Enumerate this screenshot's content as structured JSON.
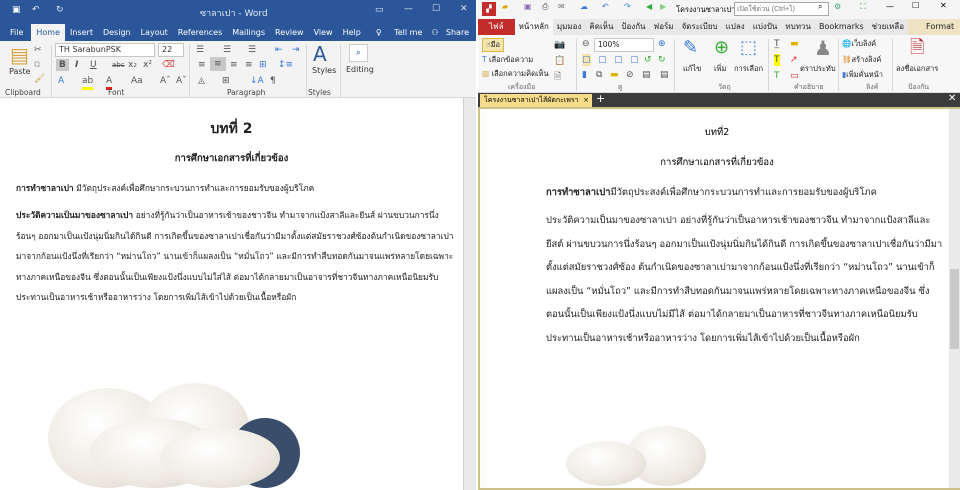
{
  "word": {
    "title": "ซาลาเปา - Word",
    "tabs": [
      "File",
      "Home",
      "Insert",
      "Design",
      "Layout",
      "References",
      "Mailings",
      "Review",
      "View",
      "Help"
    ],
    "tell_me": "Tell me",
    "share": "Share",
    "font_name": "TH SarabunPSK",
    "font_size": "22",
    "paste": "Paste",
    "styles": "Styles",
    "editing": "Editing",
    "groups": [
      "Clipboard",
      "Font",
      "Paragraph",
      "Styles"
    ],
    "doc": {
      "chapter": "บทที่ 2",
      "heading": "การศึกษาเอกสารที่เกี่ยวข้อง",
      "p1_bold": "การทำซาลาเปา",
      "p1": " มีวัตถุประสงค์เพื่อศึกษากระบวนการทำและการยอมรับของผู้บริโภค",
      "p2_bold": "ประวัติความเป็นมาของซาลาเปา",
      "p2": " อย่างที่รู้กันว่าเป็นอาหารเช้าของชาวจีน ทำมาจากแป้งสาลีและยีนส์ ผ่านขบวนการนึ่งร้อนๆ ออกมาเป็นแป้งนุ่มนิ่มกินได้กินดี การเกิดขึ้นของซาลาเปาเชื่อกันว่ามีมาตั้งแต่สมัยราชวงศ์ซ้องต้นกำเนิดของซาลาเปามาจากก้อนแป้งนึ่งที่เรียกว่า “หม่านโถว” นานเข้าก็แผลงเป็น “หมั่นโถว” และมีการทำสืบทอดกันมาจนแพร่หลายโดยเฉพาะทางภาคเหนือของจีน ซึ่งตอนนั้นเป็นเพียงแป้งนึ่งแบบไม่ใส่ไส้ ต่อมาได้กลายมาเป็นอาจารที่ชาวจีนทางภาคเหนือนิยมรับประทานเป็นอาหารเช้าหรืออาหารว่าง โดยการเพิ่มไส้เข้าไปด้วยเป็นเนื้อหรือผัก"
    }
  },
  "pdf": {
    "title": "โครงงานซาลาเปาไ",
    "search_placeholder": "เปิดใช้ด่วน (Ctrl+ไ)",
    "tabs": [
      "ไฟล์",
      "หน้าหลัก",
      "มุมมอง",
      "คิดเห็น",
      "ป้องกัน",
      "ฟอร์ม",
      "จัดระเบียบ",
      "แปลง",
      "แบ่งปัน",
      "ทบทวน",
      "Bookmarks",
      "ช่วยเหลือ",
      "Format"
    ],
    "tools": {
      "hand": "มือ",
      "select_text": "เลือกข้อความ",
      "select_comment": "เลือกความคิดเห็น",
      "zoom": "100%",
      "edit": "แก้ไข",
      "add": "เพิ่ม",
      "selection": "การเลือก",
      "stamp": "ตราประทับ",
      "web_link": "เว็บลิงค์",
      "create_link": "สร้างลิงค์",
      "add_bookmark": "เพิ่มคั่นหน้า",
      "sign": "ลงชื่อเอกสาร"
    },
    "groups": [
      "เครื่องมือ",
      "ดู",
      "วัตถุ",
      "คำอธิบาย",
      "ลิงค์",
      "ป้องกัน"
    ],
    "doc_tab": "โครงงานซาลาเปาไส้ผัดกะเพรา",
    "doc": {
      "chapter": "บทที่2",
      "heading": "การศึกษาเอกสารที่เกี่ยวข้อง",
      "p1_bold": "การทำซาลาเปา",
      "p1": "มีวัตถุประสงค์เพื่อศึกษากระบวนการทำและการยอมรับของผู้บริโภค",
      "p2": "ประวัติความเป็นมาของซาลาเปา อย่างที่รู้กันว่าเป็นอาหารเช้าของชาวจีน ทำมาจากแป้งสาลีและยีสต์ ผ่านขบวนการนึ่งร้อนๆ ออกมาเป็นแป้งนุ่มนิ่มกินได้กินดี  การเกิดขึ้นของซาลาเปาเชื่อกันว่ามีมาตั้งแต่สมัยราชวงศ์ซ้อง ต้นกำเนิดของซาลาเปามาจากก้อนแป้งนึ่งที่เรียกว่า “หม่านโถว”  นานเข้าก็แผลงเป็น “หมั่นโถว” และมีการทำสืบทอดกันมาจนแพร่หลายโดยเฉพาะทางภาคเหนือของจีน ซึ่งตอนนั้นเป็นเพียงแป้งนึ่งแบบไม่มีไส้ ต่อมาได้กลายมาเป็นอาหารที่ชาวจีนทางภาคเหนือนิยมรับประทานเป็นอาหารเช้าหรืออาหารว่าง  โดยการเพิ่มไส้เข้าไปด้วยเป็นเนื้อหรือผัก"
    }
  }
}
